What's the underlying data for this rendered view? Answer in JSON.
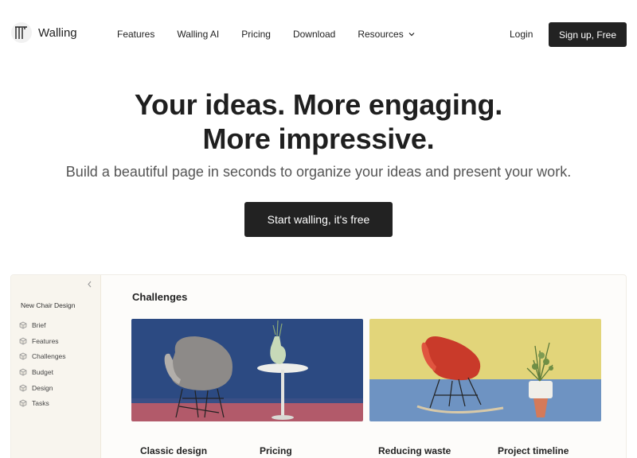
{
  "brand": {
    "name": "Walling"
  },
  "nav": {
    "items": [
      "Features",
      "Walling AI",
      "Pricing",
      "Download",
      "Resources"
    ],
    "login": "Login",
    "signup": "Sign up, Free"
  },
  "hero": {
    "title_line1": "Your ideas. More engaging.",
    "title_line2": "More impressive.",
    "subtitle": "Build a beautiful page in seconds to organize your ideas and present your work.",
    "cta": "Start walling, it's free"
  },
  "preview": {
    "sidebar_title": "New Chair Design",
    "sidebar_items": [
      "Brief",
      "Features",
      "Challenges",
      "Budget",
      "Design",
      "Tasks"
    ],
    "section_title": "Challenges",
    "column_labels": [
      "Classic design",
      "Pricing",
      "Reducing waste",
      "Project timeline"
    ]
  },
  "colors": {
    "primary_button": "#222222",
    "sidebar_bg": "#f8f5ee"
  }
}
